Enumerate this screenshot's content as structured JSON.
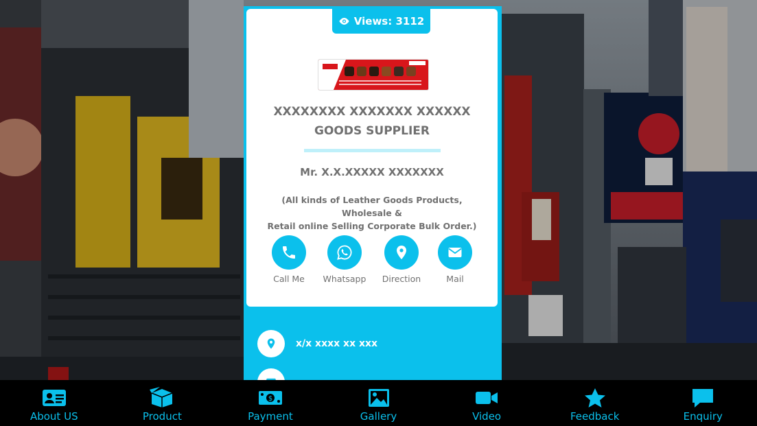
{
  "views": {
    "label": "Views: 3112"
  },
  "company": {
    "line1": "XXXXXXXX XXXXXXX XXXXXX",
    "line2": "GOODS SUPPLIER"
  },
  "person": "Mr. X.X.XXXXX XXXXXXX",
  "tagline": {
    "line1": "(All kinds of Leather Goods Products, Wholesale &",
    "line2": "Retail online Selling Corporate Bulk Order.)"
  },
  "actions": [
    {
      "label": "Call Me",
      "icon": "phone-icon"
    },
    {
      "label": "Whatsapp",
      "icon": "whatsapp-icon"
    },
    {
      "label": "Direction",
      "icon": "map-pin-icon"
    },
    {
      "label": "Mail",
      "icon": "mail-icon"
    }
  ],
  "info": [
    {
      "text": "x/x xxxx xx xxx",
      "icon": "location-icon"
    },
    {
      "text": "",
      "icon": "mail-icon"
    }
  ],
  "nav": [
    {
      "label": "About US",
      "icon": "id-card-icon"
    },
    {
      "label": "Product",
      "icon": "box-icon"
    },
    {
      "label": "Payment",
      "icon": "money-icon"
    },
    {
      "label": "Gallery",
      "icon": "image-icon"
    },
    {
      "label": "Video",
      "icon": "video-icon"
    },
    {
      "label": "Feedback",
      "icon": "star-icon"
    },
    {
      "label": "Enquiry",
      "icon": "comment-icon"
    }
  ],
  "colors": {
    "accent": "#0bc0ec",
    "text": "#707070",
    "nav_bg": "#000000"
  }
}
